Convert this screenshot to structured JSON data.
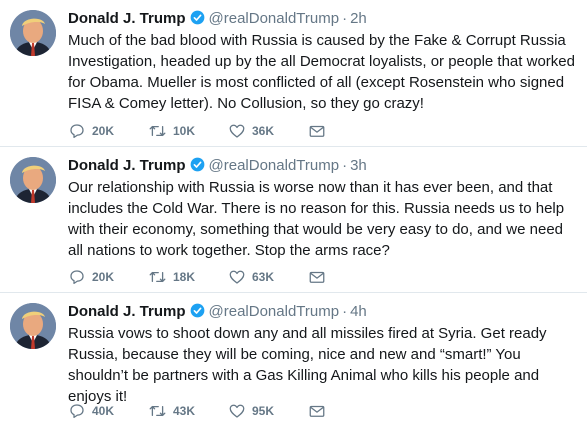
{
  "tweets": [
    {
      "name": "Donald J. Trump",
      "handle": "@realDonaldTrump",
      "time": "2h",
      "text": "Much of the bad blood with Russia is caused by the Fake & Corrupt Russia Investigation, headed up by the all Democrat loyalists, or people that worked for Obama. Mueller is most conflicted of all (except Rosenstein who signed FISA & Comey letter). No Collusion, so they go crazy!",
      "replies": "20K",
      "retweets": "10K",
      "likes": "36K"
    },
    {
      "name": "Donald J. Trump",
      "handle": "@realDonaldTrump",
      "time": "3h",
      "text": "Our relationship with Russia is worse now than it has ever been, and that includes the Cold War. There is no reason for this. Russia needs us to help with their economy, something that would be very easy to do, and we need all nations to work together. Stop the arms race?",
      "replies": "20K",
      "retweets": "18K",
      "likes": "63K"
    },
    {
      "name": "Donald J. Trump",
      "handle": "@realDonaldTrump",
      "time": "4h",
      "text": "Russia vows to shoot down any and all missiles fired at Syria. Get ready Russia, because they will be coming, nice and new and “smart!” You shouldn’t be partners with a Gas Killing Animal who kills his people and enjoys it!",
      "replies": "40K",
      "retweets": "43K",
      "likes": "95K"
    }
  ],
  "separator": "·",
  "colors": {
    "text": "#14171a",
    "muted": "#657786",
    "verified": "#1da1f2",
    "divider": "#e1e8ed"
  },
  "icons": [
    "verified-badge-icon",
    "reply-icon",
    "retweet-icon",
    "like-icon",
    "direct-message-icon"
  ]
}
